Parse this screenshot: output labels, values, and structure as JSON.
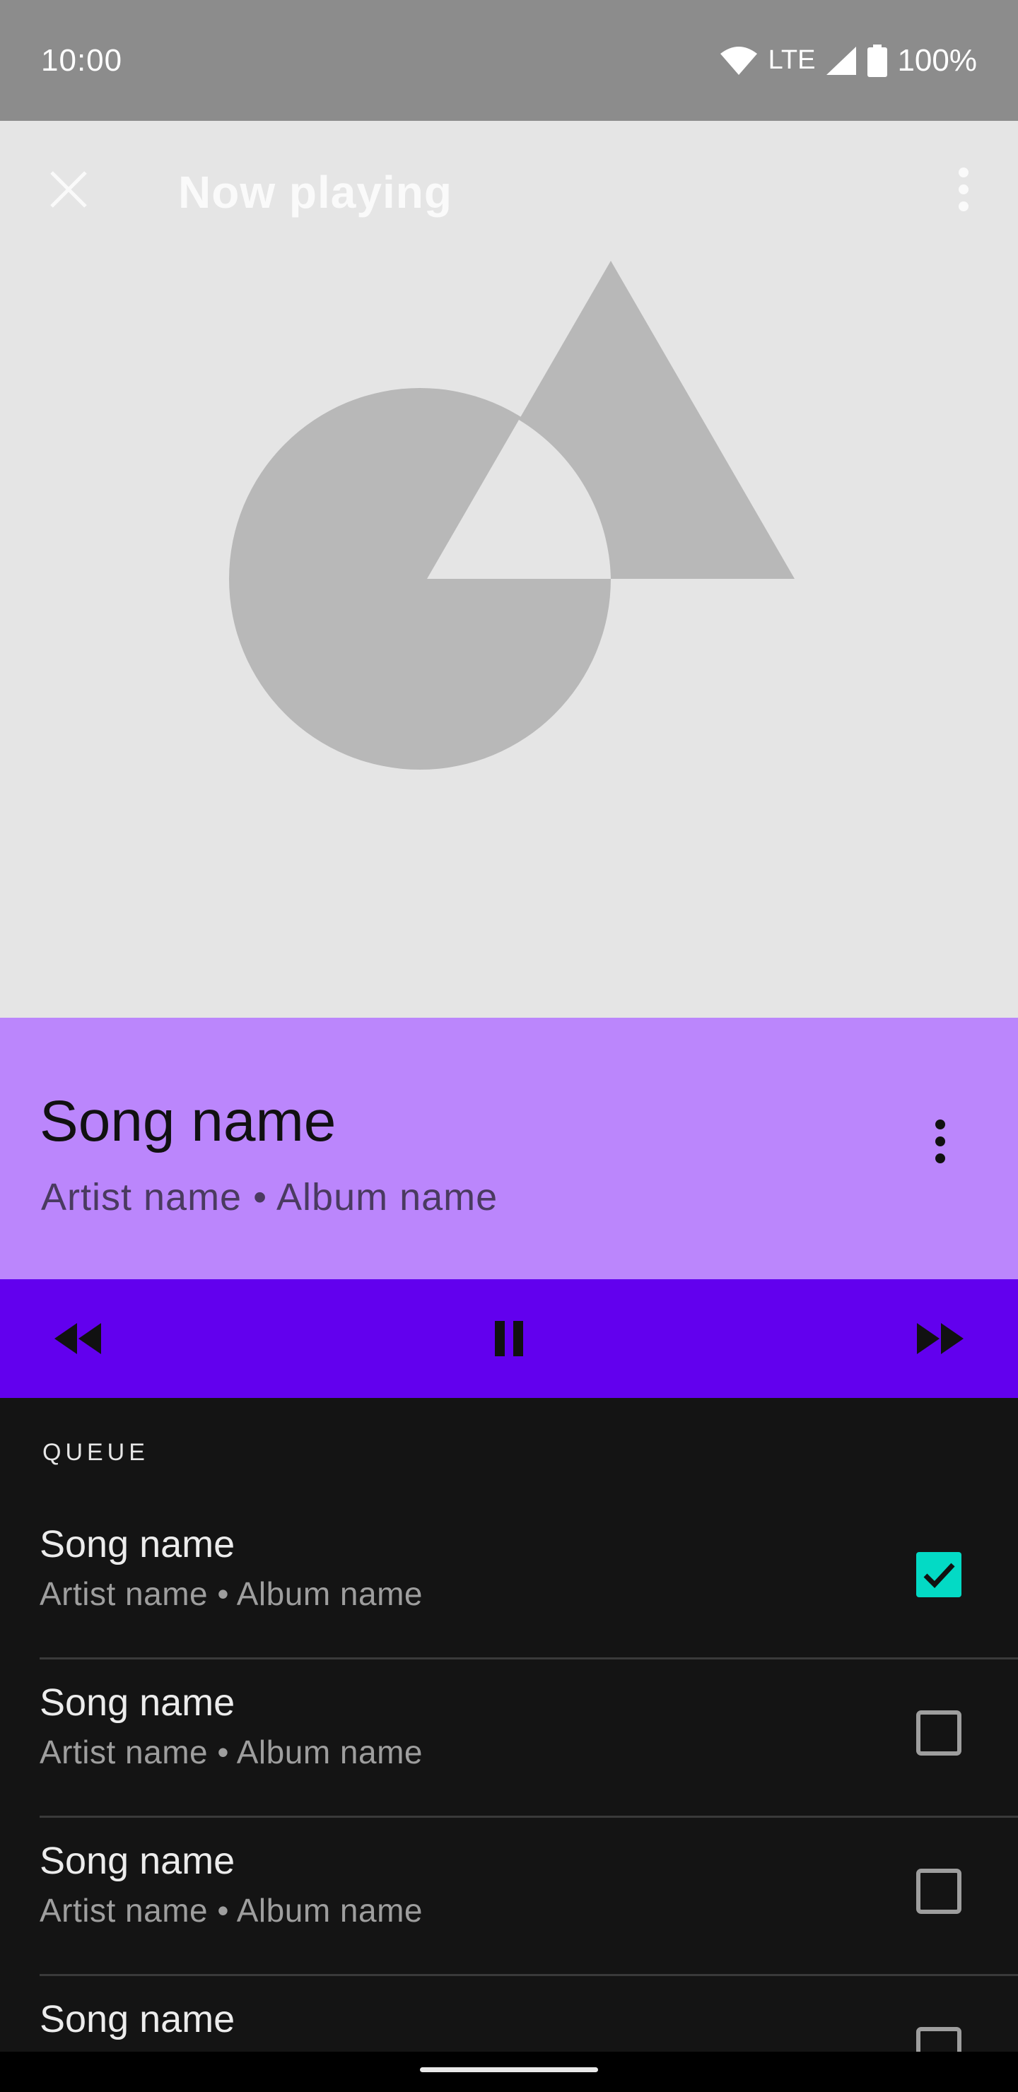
{
  "status_bar": {
    "time": "10:00",
    "network": "LTE",
    "battery": "100%",
    "icons": [
      "wifi-icon",
      "cell-signal-icon",
      "battery-icon"
    ]
  },
  "header": {
    "title": "Now playing",
    "close_icon": "close-icon",
    "menu_icon": "more-vert-icon"
  },
  "now_playing": {
    "song": "Song name",
    "meta": "Artist name • Album name",
    "menu_icon": "more-vert-icon"
  },
  "controls": {
    "icons": [
      "rewind-icon",
      "pause-icon",
      "fast-forward-icon"
    ]
  },
  "queue": {
    "header": "QUEUE",
    "items": [
      {
        "title": "Song name",
        "meta": "Artist name • Album name",
        "checked": true
      },
      {
        "title": "Song name",
        "meta": "Artist name • Album name",
        "checked": false
      },
      {
        "title": "Song name",
        "meta": "Artist name • Album name",
        "checked": false
      },
      {
        "title": "Song name",
        "meta": "",
        "checked": false
      }
    ]
  },
  "colors": {
    "status_bar": "#8c8c8c",
    "hero_bg": "#e5e5e5",
    "art_shape": "#b8b8b8",
    "info_bg": "#bb86fc",
    "controls_bg": "#6200ee",
    "queue_bg": "#141414",
    "check_accent": "#03dac5"
  }
}
